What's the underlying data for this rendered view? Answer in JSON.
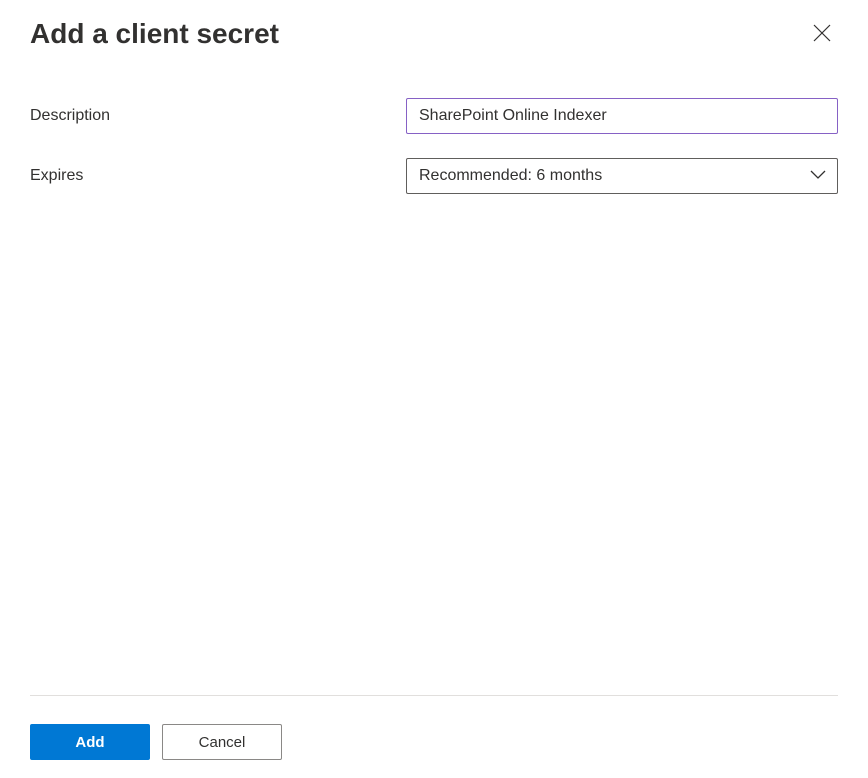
{
  "header": {
    "title": "Add a client secret"
  },
  "form": {
    "description": {
      "label": "Description",
      "value": "SharePoint Online Indexer"
    },
    "expires": {
      "label": "Expires",
      "selected": "Recommended: 6 months"
    }
  },
  "footer": {
    "add_label": "Add",
    "cancel_label": "Cancel"
  }
}
